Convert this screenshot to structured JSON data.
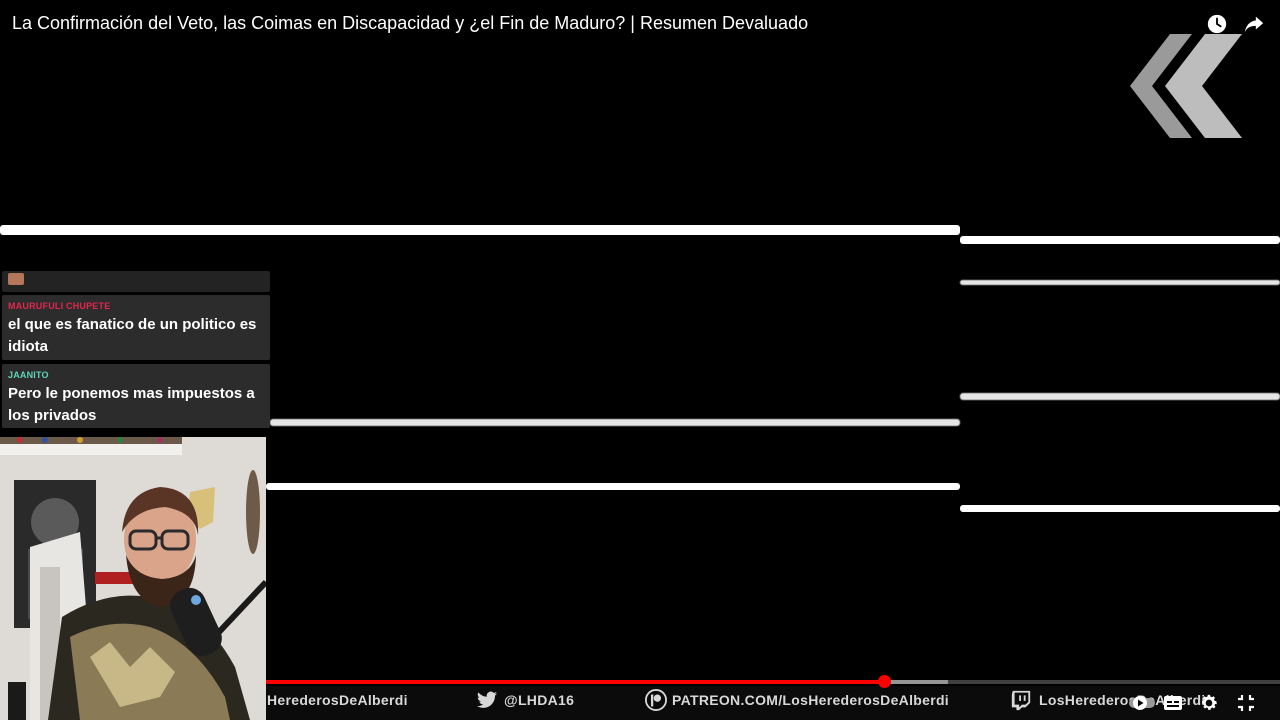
{
  "video": {
    "title": "La Confirmación del Veto, las Coimas en Discapacidad y ¿el Fin de Maduro? | Resumen Devaluado",
    "progress_percent": 61,
    "buffered_percent": 67
  },
  "top_controls": {
    "watch_later_icon": "clock-icon",
    "share_icon": "share-arrow-icon"
  },
  "chat": {
    "messages": [
      {
        "user": "MAURUFULI CHUPETE",
        "user_color": "#e0264f",
        "text": "el que es fanatico de un politico es idiota"
      },
      {
        "user": "JAANITO",
        "user_color": "#5fd4b8",
        "text": "Pero le ponemos mas impuestos a los privados"
      }
    ]
  },
  "banner": {
    "items": [
      {
        "icon": "",
        "text": "HerederosDeAlberdi"
      },
      {
        "icon": "twitter-bird-icon",
        "text": "@LHDA16"
      },
      {
        "icon": "patreon-icon",
        "text": "PATREON.COM/LosHerederosDeAlberdi"
      },
      {
        "icon": "twitch-icon",
        "text": "LosHerederosDeAlberdi"
      }
    ]
  },
  "controls": {
    "autoplay_icon": "autoplay-toggle-icon",
    "captions_icon": "captions-icon",
    "settings_icon": "gear-icon",
    "fullscreen_exit_icon": "exit-fullscreen-icon"
  },
  "colors": {
    "progress": "#ff0000",
    "background": "#000000"
  }
}
